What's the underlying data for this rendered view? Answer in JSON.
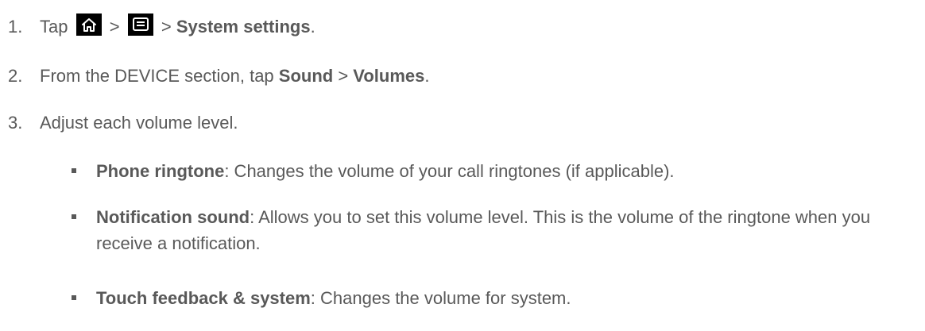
{
  "steps": [
    {
      "number": "1.",
      "tap": "Tap",
      "sep1": ">",
      "sep2": ">",
      "target": "System settings",
      "end": ".",
      "icons": [
        "home-icon",
        "menu-icon"
      ]
    },
    {
      "number": "2.",
      "prefix": "From the DEVICE section, tap ",
      "bold1": "Sound",
      "sep": " > ",
      "bold2": "Volumes",
      "end": "."
    },
    {
      "number": "3.",
      "text": "Adjust each volume level."
    }
  ],
  "bullets": [
    {
      "term": "Phone ringtone",
      "description": ": Changes the volume of your call ringtones (if applicable)."
    },
    {
      "term": "Notification sound",
      "description": ": Allows you to set this volume level. This is the volume of the ringtone when you receive a notification."
    },
    {
      "term": "Touch feedback & system",
      "description": ": Changes the volume for system."
    }
  ],
  "colors": {
    "text": "#595959",
    "icon_background": "#000000",
    "icon_glyph": "#ffffff"
  }
}
